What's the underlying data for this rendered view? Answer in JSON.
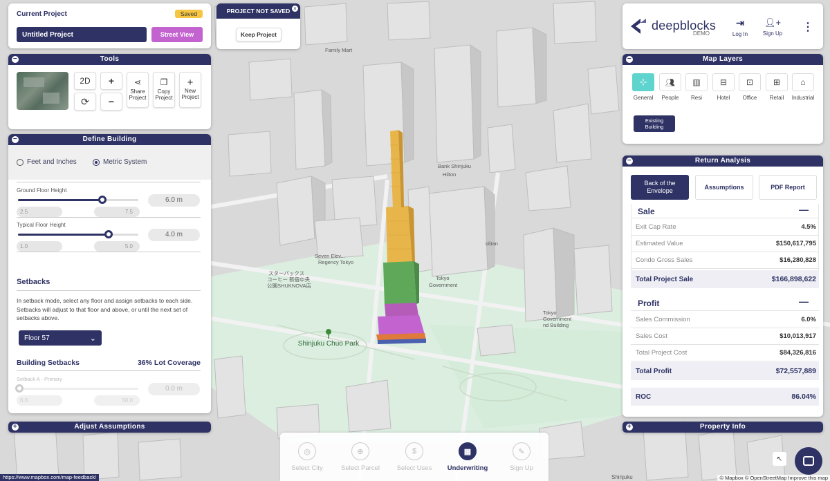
{
  "project": {
    "title": "Current Project",
    "status": "Saved",
    "name": "Untitled Project",
    "street_view": "Street View"
  },
  "unsaved": {
    "title": "PROJECT NOT SAVED",
    "keep": "Keep Project"
  },
  "tools": {
    "title": "Tools",
    "btn_2d": "2D",
    "share": "Share Project",
    "copy": "Copy Project",
    "new": "New Project"
  },
  "define": {
    "title": "Define Building",
    "unit_feet": "Feet and Inches",
    "unit_metric": "Metric System",
    "ground_label": "Ground Floor Height",
    "ground_value": "6.0 m",
    "ground_min": "2.5",
    "ground_max": "7.5",
    "ground_fraction": 0.7,
    "typical_label": "Typical Floor Height",
    "typical_value": "4.0 m",
    "typical_min": "1.0",
    "typical_max": "5.0",
    "typical_fraction": 0.75,
    "setbacks_title": "Setbacks",
    "setbacks_desc": "In setback mode, select any floor and assign setbacks to each side. Setbacks will adjust to that floor and above, or until the next set of setbacks above.",
    "floor_select": "Floor 57",
    "bs_title": "Building Setbacks",
    "lot_coverage": "36% Lot Coverage",
    "sa_label": "Setback A - Primary",
    "sa_value": "0.0 m",
    "sa_min": "0.0",
    "sa_max": "50.0"
  },
  "adjust": {
    "title": "Adjust Assumptions"
  },
  "brand": {
    "name": "deepblocks",
    "demo": "DEMO",
    "login": "Log In",
    "signup": "Sign Up"
  },
  "layers": {
    "title": "Map Layers",
    "items": [
      "General",
      "People",
      "Resi",
      "Hotel",
      "Office",
      "Retail",
      "Industrial"
    ],
    "existing": "Existing Building"
  },
  "returns": {
    "title": "Return Analysis",
    "tabs": [
      "Back of the Envelope",
      "Assumptions",
      "PDF Report"
    ],
    "sale_title": "Sale",
    "sale_rows": [
      {
        "k": "Exit Cap Rate",
        "v": "4.5%"
      },
      {
        "k": "Estimated Value",
        "v": "$150,617,795"
      },
      {
        "k": "Condo Gross Sales",
        "v": "$16,280,828"
      }
    ],
    "sale_total_k": "Total Project Sale",
    "sale_total_v": "$166,898,622",
    "profit_title": "Profit",
    "profit_rows": [
      {
        "k": "Sales Commission",
        "v": "6.0%"
      },
      {
        "k": "Sales Cost",
        "v": "$10,013,917"
      },
      {
        "k": "Total Project Cost",
        "v": "$84,326,816"
      }
    ],
    "profit_total_k": "Total Profit",
    "profit_total_v": "$72,557,889",
    "roc_k": "ROC",
    "roc_v": "86.04%"
  },
  "property": {
    "title": "Property Info"
  },
  "steps": [
    "Select City",
    "Select Parcel",
    "Select Uses",
    "Underwriting",
    "Sign Up"
  ],
  "map": {
    "park_name": "Shinjuku Chuo Park",
    "labels": {
      "seven": "Seven Elev...",
      "regency": "Regency Tokyo",
      "starbucks": "スターバックス",
      "starbucks2": "コーヒー 新宿中央",
      "starbucks3": "公園SHUKNOVA店",
      "gov": "Tokyo",
      "gov2": "Government",
      "gov3": "Tokyo",
      "gov4": "Government",
      "gov5": "nd Building",
      "politan": "olitan",
      "bank": "Bank Shinjuku",
      "hilton": "Hilton",
      "family": "Family Mart"
    },
    "feedback": "https://www.mapbox.com/map-feedback/",
    "attribution": "© Mapbox © OpenStreetMap Improve this map",
    "station": "Shinjuku"
  },
  "colors": {
    "navy": "#2e3264",
    "purple": "#c363cf",
    "teal": "#5fd4cf",
    "saved": "#f5c543"
  }
}
